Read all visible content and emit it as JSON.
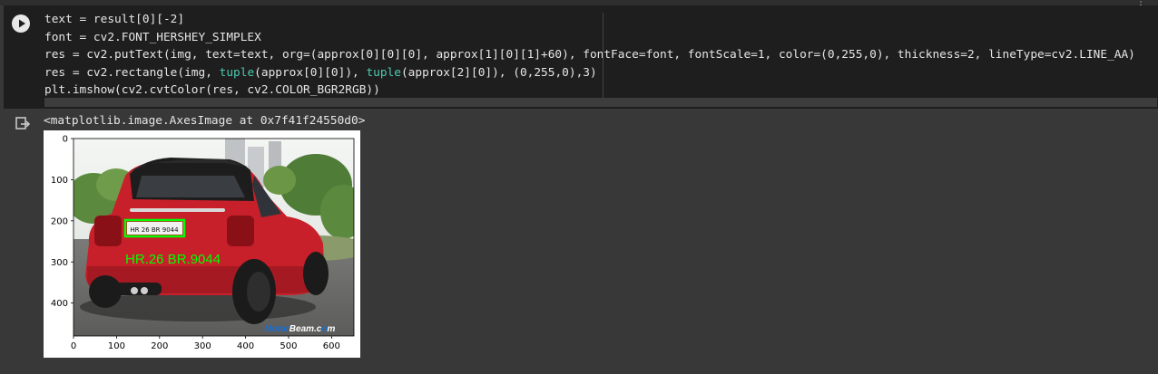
{
  "code_cell": {
    "run_label": "Run cell",
    "lines": [
      [
        {
          "t": "text = result[0][-2]"
        }
      ],
      [
        {
          "t": "font = cv2.FONT_HERSHEY_SIMPLEX"
        }
      ],
      [
        {
          "t": "res = cv2.putText(img, text=text, org=(approx[0][0][0], approx[1][0][1]+60), fontFace=font, fontScale=1, color=(0,255,0), thickness=2, lineType=cv2.LINE_AA)"
        }
      ],
      [
        {
          "t": "res = cv2.rectangle(img, "
        },
        {
          "t": "tuple",
          "c": "fn"
        },
        {
          "t": "(approx[0][0]), "
        },
        {
          "t": "tuple",
          "c": "fn"
        },
        {
          "t": "(approx[2][0]), (0,255,0),3)"
        }
      ],
      [
        {
          "t": "plt.imshow(cv2.cvtColor(res, cv2.COLOR_BGR2RGB))"
        }
      ]
    ]
  },
  "output": {
    "text": "<matplotlib.image.AxesImage at 0x7f41f24550d0>",
    "plot": {
      "y_ticks": [
        "0",
        "100",
        "200",
        "300",
        "400"
      ],
      "x_ticks": [
        "0",
        "100",
        "200",
        "300",
        "400",
        "500",
        "600"
      ],
      "plate_text": "HR 26 BR 9044",
      "overlay_text": "HR.26  BR.9044",
      "watermark_a": "Motor",
      "watermark_b": "Beam.c",
      "watermark_c": "m"
    }
  },
  "colors": {
    "cell_bg": "#1e1e1e",
    "page_bg": "#383838",
    "overlay_green": "#00ff00",
    "car_red": "#c8202a"
  },
  "icons": {
    "run": "play-circle-icon",
    "output": "output-arrow-icon",
    "corner": "more-icon"
  }
}
